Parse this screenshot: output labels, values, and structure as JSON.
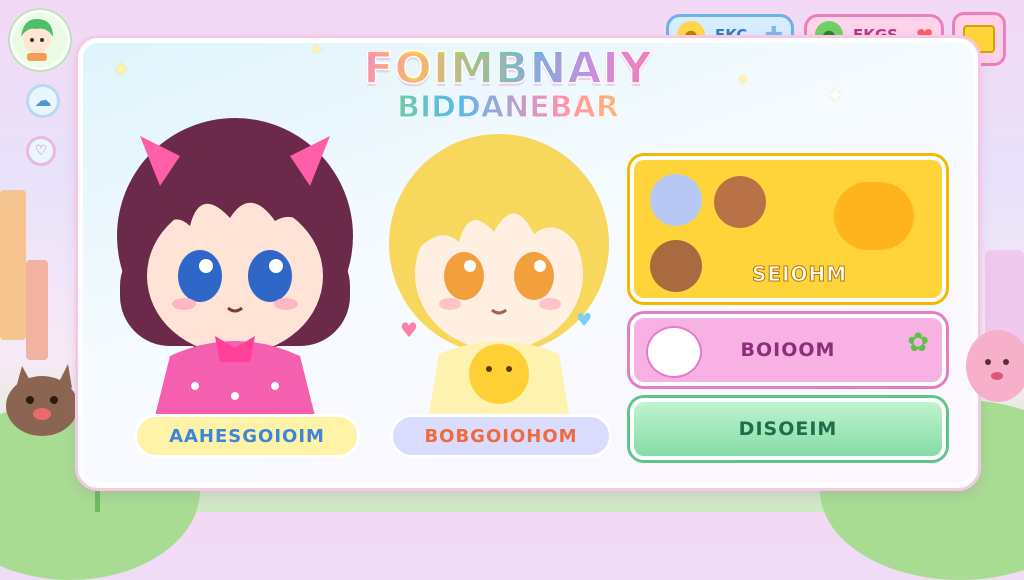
{
  "game": {
    "title_line1": "FOIMBNAIY",
    "title_line2": "BIDDANEBAR"
  },
  "hud": {
    "currency1": {
      "label": "EKC",
      "icon": "chick-icon"
    },
    "currency2": {
      "label": "EKGS",
      "icon": "gem-icon"
    }
  },
  "characters": {
    "left": {
      "name": "AAHESGOIOIM"
    },
    "right": {
      "name": "BOBGOIOHOM"
    }
  },
  "menu": {
    "card1": {
      "label": "SEIOHM"
    },
    "card2": {
      "label": "BOIOOM"
    },
    "card3": {
      "label": "DISOEIM"
    }
  },
  "colors": {
    "accent_pink": "#f6a6d6",
    "accent_yellow": "#ffd43b",
    "accent_green": "#8ee6ac",
    "accent_blue": "#8fd0f5"
  }
}
